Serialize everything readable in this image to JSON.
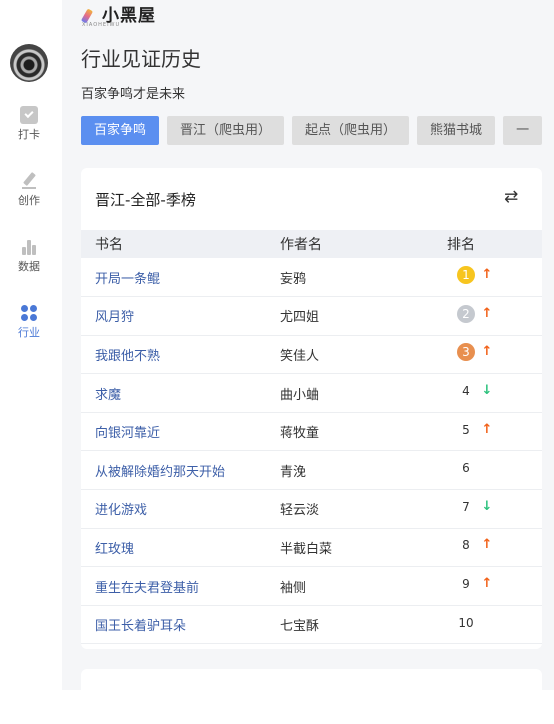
{
  "sidebar": {
    "items": [
      {
        "label": "打卡",
        "icon": "checkin-icon"
      },
      {
        "label": "创作",
        "icon": "pen-icon"
      },
      {
        "label": "数据",
        "icon": "bar-chart-icon"
      },
      {
        "label": "行业",
        "icon": "dots-grid-icon",
        "active": true
      }
    ]
  },
  "header": {
    "logo_text": "小黑屋",
    "logo_sub": "XIAOHEIWU",
    "title": "行业见证历史",
    "subtitle": "百家争鸣才是未来"
  },
  "tabs": [
    "百家争鸣",
    "晋江（爬虫用）",
    "起点（爬虫用）",
    "熊猫书城",
    "一"
  ],
  "card": {
    "title": "晋江-全部-季榜",
    "columns": [
      "书名",
      "作者名",
      "排名"
    ],
    "rows": [
      {
        "book": "开局一条鲲",
        "author": "妄鸦",
        "rank": "1",
        "trend": "up"
      },
      {
        "book": "风月狩",
        "author": "尤四姐",
        "rank": "2",
        "trend": "up"
      },
      {
        "book": "我跟他不熟",
        "author": "笑佳人",
        "rank": "3",
        "trend": "up"
      },
      {
        "book": "求魔",
        "author": "曲小蛐",
        "rank": "4",
        "trend": "down"
      },
      {
        "book": "向银河靠近",
        "author": "蒋牧童",
        "rank": "5",
        "trend": "up"
      },
      {
        "book": "从被解除婚约那天开始",
        "author": "青浼",
        "rank": "6",
        "trend": "none"
      },
      {
        "book": "进化游戏",
        "author": "轻云淡",
        "rank": "7",
        "trend": "down"
      },
      {
        "book": "红玫瑰",
        "author": "半截白菜",
        "rank": "8",
        "trend": "up"
      },
      {
        "book": "重生在夫君登基前",
        "author": "袖侧",
        "rank": "9",
        "trend": "up"
      },
      {
        "book": "国王长着驴耳朵",
        "author": "七宝酥",
        "rank": "10",
        "trend": "none"
      }
    ]
  },
  "colors": {
    "accent": "#5b8ff0",
    "link": "#3d5fa8",
    "up": "#f2621a",
    "down": "#2ec27e",
    "gold": "#f7c51f",
    "silver": "#c5c9cf",
    "bronze": "#e88f4f"
  }
}
